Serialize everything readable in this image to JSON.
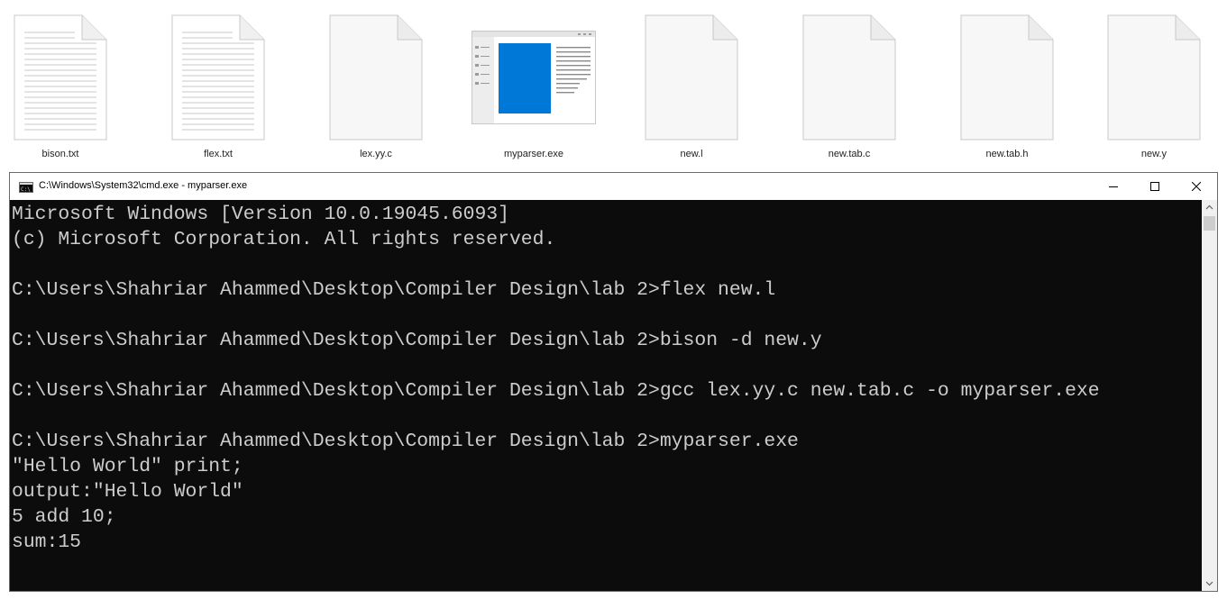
{
  "desktop": {
    "files": [
      {
        "name": "bison.txt",
        "icon": "text-document-icon"
      },
      {
        "name": "flex.txt",
        "icon": "text-document-icon"
      },
      {
        "name": "lex.yy.c",
        "icon": "blank-document-icon"
      },
      {
        "name": "myparser.exe",
        "icon": "application-window-icon"
      },
      {
        "name": "new.l",
        "icon": "blank-document-icon"
      },
      {
        "name": "new.tab.c",
        "icon": "blank-document-icon"
      },
      {
        "name": "new.tab.h",
        "icon": "blank-document-icon"
      },
      {
        "name": "new.y",
        "icon": "blank-document-icon"
      }
    ]
  },
  "window": {
    "title": "C:\\Windows\\System32\\cmd.exe - myparser.exe",
    "icon": "cmd-icon",
    "controls": [
      "minimize-icon",
      "maximize-icon",
      "close-icon"
    ]
  },
  "console": {
    "lines": [
      "Microsoft Windows [Version 10.0.19045.6093]",
      "(c) Microsoft Corporation. All rights reserved.",
      "",
      "C:\\Users\\Shahriar Ahammed\\Desktop\\Compiler Design\\lab 2>flex new.l",
      "",
      "C:\\Users\\Shahriar Ahammed\\Desktop\\Compiler Design\\lab 2>bison -d new.y",
      "",
      "C:\\Users\\Shahriar Ahammed\\Desktop\\Compiler Design\\lab 2>gcc lex.yy.c new.tab.c -o myparser.exe",
      "",
      "C:\\Users\\Shahriar Ahammed\\Desktop\\Compiler Design\\lab 2>myparser.exe",
      "\"Hello World\" print;",
      "output:\"Hello World\"",
      "5 add 10;",
      "sum:15"
    ]
  },
  "colors": {
    "console_bg": "#0c0c0c",
    "console_fg": "#cccccc",
    "titlebar_bg": "#ffffff",
    "exe_accent": "#0078d7"
  }
}
